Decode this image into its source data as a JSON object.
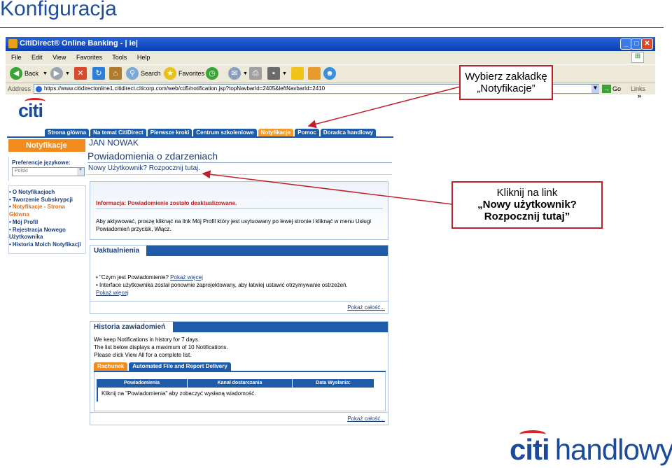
{
  "slide": {
    "title": "Konfiguracja"
  },
  "browser": {
    "title": "CitiDirect® Online Banking - | ie|",
    "menu": [
      "File",
      "Edit",
      "View",
      "Favorites",
      "Tools",
      "Help"
    ],
    "toolbar": {
      "back": "Back",
      "search": "Search",
      "favorites": "Favorites"
    },
    "address_label": "Address",
    "address_url": "https://www.citidirectonline1.citidirect.citicorp.com/web/cd5/notification.jsp?topNavbarId=2405&leftNavbarId=2410",
    "go": "Go",
    "links": "Links",
    "chevron": "»"
  },
  "page": {
    "logo": "citi",
    "nav_tabs": [
      "Strona główna",
      "Na temat CitiDirect",
      "Pierwsze kroki",
      "Centrum szkoleniowe",
      "Notyfikacje",
      "Pomoc",
      "Doradca handlowy"
    ],
    "active_tab_index": 4,
    "section_badge": "Notyfikacje",
    "user_name": "JAN NOWAK",
    "page_heading": "Powiadomienia o zdarzeniach",
    "new_user_link": "Nowy Użytkownik? Rozpocznij tutaj.",
    "language": {
      "label": "Preferencje językowe:",
      "value": "Polski"
    },
    "side_nav": [
      "O Notyfikacjach",
      "Tworzenie Subskrypcji",
      "Notyfikacje - Strona Główna",
      "Mój Profil",
      "Rejestracja Nowego Użytkownika",
      "Historia Moich Notyfikacji"
    ],
    "info": {
      "title": "Informacja: Powiadomienie zostało deaktualizowane.",
      "body": "Aby aktywować, proszę kliknąć na link Mój Profil który jest usytuowany po lewej stronie i kliknąć w menu Usługi Powiadomień przycisk, Włącz."
    },
    "updates": {
      "heading": "Uaktualnienia",
      "items": [
        {
          "text": "\"Czym jest Powiadomienie?",
          "link": "Pokaż więcej"
        },
        {
          "text": "Interface użytkownika został ponownie zaprojektowany, aby łatwiej ustawić otrzymywanie ostrzeżeń.",
          "link": "Pokaż więcej"
        }
      ],
      "show_all": "Pokaż całość..."
    },
    "history": {
      "heading": "Historia zawiadomień",
      "lines": [
        "We keep Notifications in history for 7 days.",
        "The list below displays a maximum of 10 Notifications.",
        "Please click View All for a complete list."
      ],
      "tabs": [
        "Rachunek",
        "Automated File and Report Delivery"
      ],
      "columns": [
        "Powiadomienia",
        "Kanał dostarczania",
        "Data Wysłania:"
      ],
      "message": "Kliknij na \"Powiadomienia\" aby zobaczyć wysłaną wiadomość.",
      "show_all": "Pokaż całość..."
    }
  },
  "callouts": {
    "tab": {
      "line1": "Wybierz zakładkę",
      "line2": "„Notyfikacje”"
    },
    "link": {
      "line1": "Kliknij na link",
      "line2": "„Nowy użytkownik?",
      "line3": "Rozpocznij tutaj”"
    }
  },
  "brand": {
    "citi": "citi",
    "handlowy": "handlowy"
  },
  "colors": {
    "accent_blue": "#1e5ba8",
    "tab_orange": "#f28a1e",
    "callout_red": "#c0202a",
    "title_blue": "#1f4e99"
  }
}
